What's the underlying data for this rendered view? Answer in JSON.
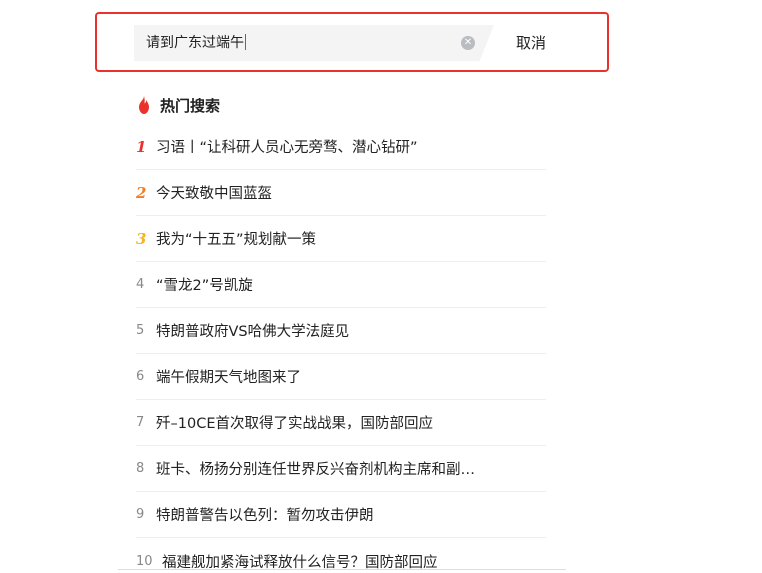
{
  "search": {
    "query": "请到广东过端午",
    "cancel_label": "取消",
    "clear_icon": "clear-icon"
  },
  "hot": {
    "title": "热门搜索",
    "icon": "flame-icon",
    "accent": "#e8322b",
    "items": [
      {
        "rank": "1",
        "text": "习语丨“让科研人员心无旁骛、潜心钻研”"
      },
      {
        "rank": "2",
        "text": "今天致敬中国蓝盔"
      },
      {
        "rank": "3",
        "text": "我为“十五五”规划献一策"
      },
      {
        "rank": "4",
        "text": "“雪龙2”号凯旋"
      },
      {
        "rank": "5",
        "text": "特朗普政府VS哈佛大学法庭见"
      },
      {
        "rank": "6",
        "text": "端午假期天气地图来了"
      },
      {
        "rank": "7",
        "text": "歼–10CE首次取得了实战战果，国防部回应"
      },
      {
        "rank": "8",
        "text": "班卡、杨扬分别连任世界反兴奋剂机构主席和副…"
      },
      {
        "rank": "9",
        "text": "特朗普警告以色列：暂勿攻击伊朗"
      },
      {
        "rank": "10",
        "text": "福建舰加紧海试释放什么信号？国防部回应"
      }
    ]
  }
}
